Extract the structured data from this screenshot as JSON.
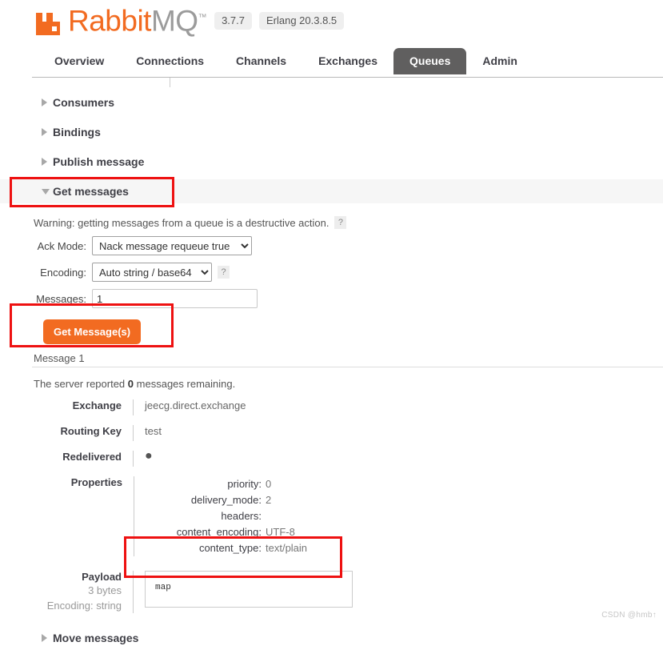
{
  "header": {
    "logo_rabbit": "Rabbit",
    "logo_mq": "MQ",
    "logo_tm": "™",
    "version_badge": "3.7.7",
    "erlang_badge": "Erlang 20.3.8.5"
  },
  "nav": {
    "tabs": [
      {
        "label": "Overview",
        "active": false
      },
      {
        "label": "Connections",
        "active": false
      },
      {
        "label": "Channels",
        "active": false
      },
      {
        "label": "Exchanges",
        "active": false
      },
      {
        "label": "Queues",
        "active": true
      },
      {
        "label": "Admin",
        "active": false
      }
    ]
  },
  "sections": {
    "consumers": "Consumers",
    "bindings": "Bindings",
    "publish_message": "Publish message",
    "get_messages": "Get messages",
    "move_messages": "Move messages"
  },
  "get_messages": {
    "warning": "Warning: getting messages from a queue is a destructive action.",
    "warning_help": "?",
    "ack_mode_label": "Ack Mode:",
    "ack_mode_value": "Nack message requeue true",
    "ack_mode_options": [
      "Nack message requeue true"
    ],
    "encoding_label": "Encoding:",
    "encoding_value": "Auto string / base64",
    "encoding_options": [
      "Auto string / base64"
    ],
    "encoding_help": "?",
    "messages_label": "Messages:",
    "messages_value": "1",
    "get_button": "Get Message(s)"
  },
  "result": {
    "message_title": "Message 1",
    "reported_prefix": "The server reported",
    "reported_count": "0",
    "reported_suffix": "messages remaining.",
    "rows": [
      {
        "key": "Exchange",
        "value": "jeecg.direct.exchange"
      },
      {
        "key": "Routing Key",
        "value": "test"
      },
      {
        "key": "Redelivered",
        "value": "●"
      }
    ],
    "properties_label": "Properties",
    "properties": [
      {
        "name": "priority:",
        "value": "0"
      },
      {
        "name": "delivery_mode:",
        "value": "2"
      },
      {
        "name": "headers:",
        "value": ""
      },
      {
        "name": "content_encoding:",
        "value": "UTF-8"
      },
      {
        "name": "content_type:",
        "value": "text/plain"
      }
    ],
    "payload_label": "Payload",
    "payload_size": "3 bytes",
    "payload_encoding": "Encoding: string",
    "payload_body": "map"
  },
  "watermark": "CSDN @hmb↑",
  "colors": {
    "brand_orange": "#f26b21",
    "active_tab": "#605f5f",
    "annotation_red": "#ee1111"
  }
}
